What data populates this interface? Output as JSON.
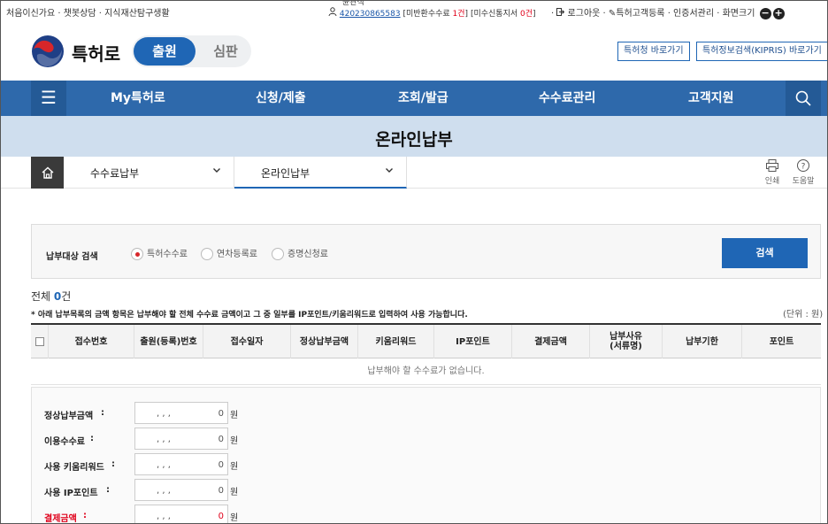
{
  "util": {
    "links": [
      "처음이신가요",
      "챗봇상담",
      "지식재산탐구생활"
    ],
    "user_name": "윤관식",
    "user_id": "420230865583",
    "unpaid_prefix": "[미반환수수료 ",
    "unpaid_count": "1건",
    "unpaid_suffix": "]",
    "notice_prefix": "[미수신통지서 ",
    "notice_count": "0건",
    "notice_suffix": "]",
    "logout": "로그아웃",
    "register": "특허고객등록",
    "cert": "인증서관리",
    "screen_size": "화면크기"
  },
  "header": {
    "brand": "특허로",
    "toggle_on": "출원",
    "toggle_off": "심판",
    "btn_kipo": "특허청 바로가기",
    "btn_kipris": "특허정보검색(KIPRIS) 바로가기"
  },
  "nav": {
    "items": [
      "My특허로",
      "신청/제출",
      "조회/발급",
      "수수료관리",
      "고객지원"
    ]
  },
  "page": {
    "title": "온라인납부",
    "crumb1": "수수료납부",
    "crumb2": "온라인납부",
    "print": "인쇄",
    "help": "도움말"
  },
  "search": {
    "label": "납부대상 검색",
    "options": [
      "특허수수료",
      "연차등록료",
      "증명신청료"
    ],
    "selected": "특허수수료",
    "button": "검색"
  },
  "list": {
    "total_prefix": "전체 ",
    "total_count": "0",
    "total_suffix": "건",
    "note": "* 아래 납부목록의 금액 항목은 납부해야 할 전체 수수료 금액이고 그 중 일부를 IP포인트/키움리워드로 입력하여 사용 가능합니다.",
    "unit": "(단위 : 원)",
    "columns": [
      "접수번호",
      "출원(등록)번호",
      "접수일자",
      "정상납부금액",
      "키움리워드",
      "IP포인트",
      "결제금액",
      "납부사유\n(서류명)",
      "납부기한",
      "포인트"
    ],
    "empty": "납부해야 할 수수료가 없습니다."
  },
  "summary": {
    "rows": [
      {
        "label": "정상납부금액",
        "value": "0"
      },
      {
        "label": "이용수수료",
        "value": "0"
      },
      {
        "label": "사용 키움리워드",
        "value": "0"
      },
      {
        "label": "사용 IP포인트",
        "value": "0"
      },
      {
        "label": "결제금액",
        "value": "0"
      }
    ],
    "separators": ",     ,     ,",
    "currency": "원"
  },
  "colors": {
    "primary": "#1f66b5",
    "nav": "#2e69ab",
    "band": "#cfdeee",
    "alert": "#e0001a"
  }
}
